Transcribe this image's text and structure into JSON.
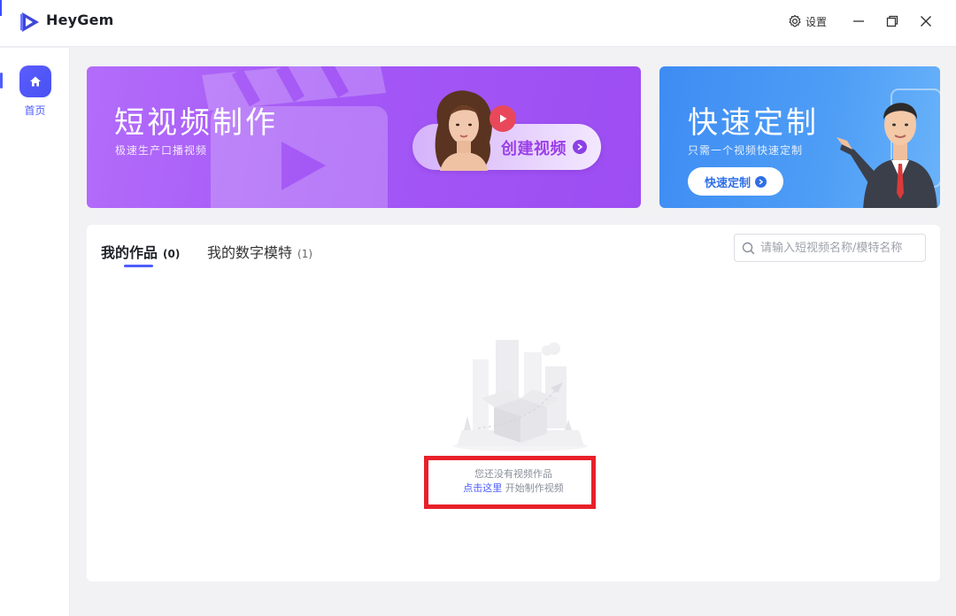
{
  "app": {
    "name": "HeyGem"
  },
  "titlebar": {
    "settings_label": "设置"
  },
  "sidebar": {
    "items": [
      {
        "label": "首页",
        "icon": "home-icon",
        "active": true
      }
    ]
  },
  "banners": {
    "video": {
      "title": "短视频制作",
      "subtitle": "极速生产口播视频",
      "button_label": "创建视频"
    },
    "custom": {
      "title": "快速定制",
      "subtitle": "只需一个视频快速定制",
      "button_label": "快速定制"
    }
  },
  "works": {
    "tabs": [
      {
        "label": "我的作品",
        "count": "(0)",
        "active": true
      },
      {
        "label": "我的数字模特",
        "count": "(1)",
        "active": false
      }
    ],
    "search": {
      "placeholder": "请输入短视频名称/模特名称"
    },
    "empty": {
      "message": "您还没有视频作品",
      "link_label": "点击这里",
      "link_suffix": " 开始制作视频"
    }
  },
  "colors": {
    "accent": "#4d5cff",
    "video_banner": "#a458f6",
    "custom_banner": "#4e9ef6",
    "highlight_box": "#e8202a"
  }
}
